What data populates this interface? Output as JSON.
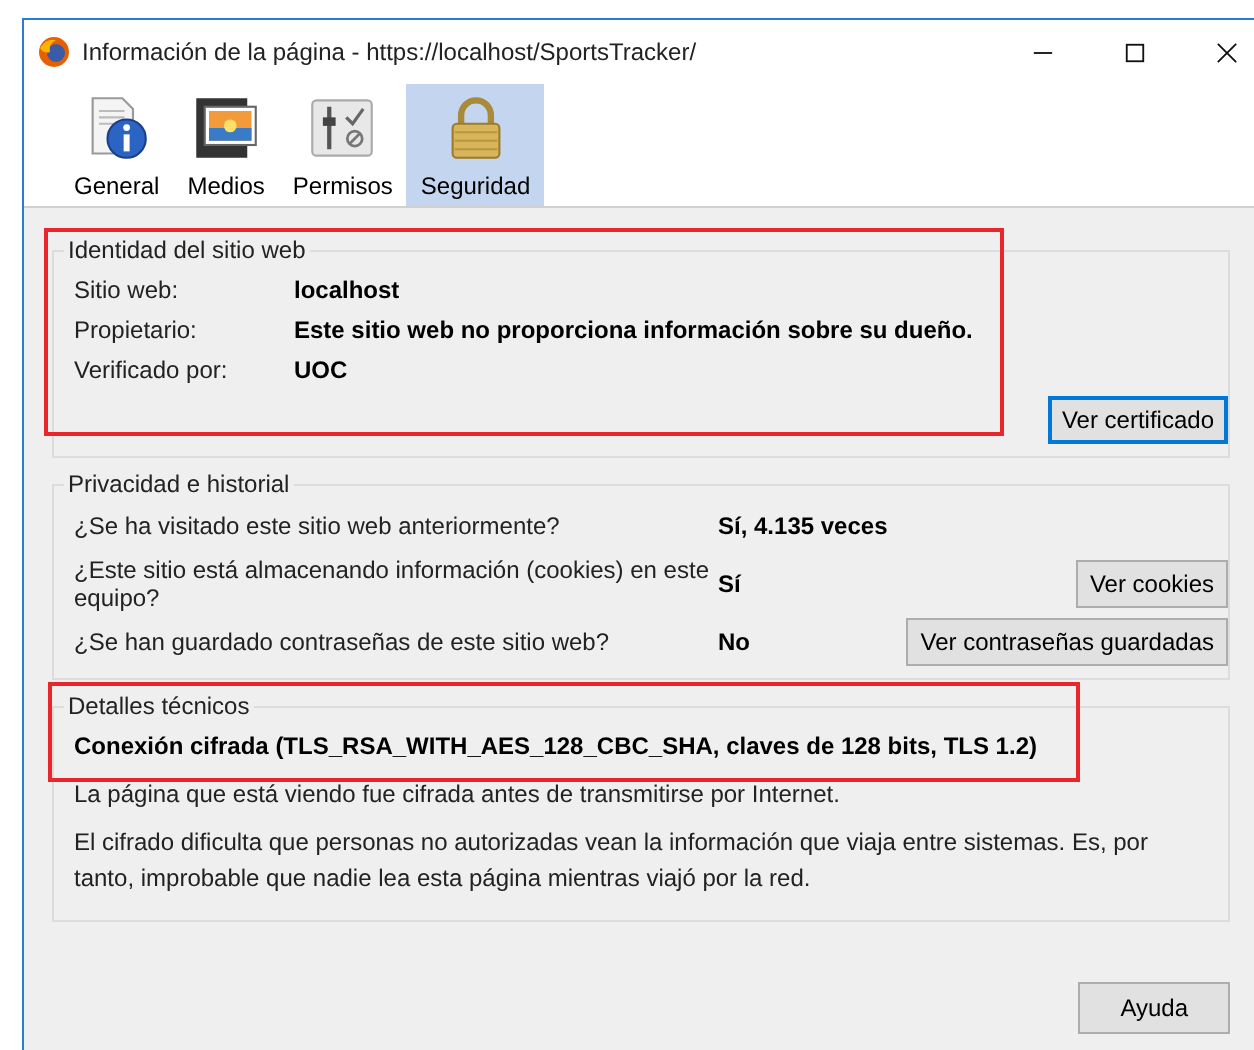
{
  "window": {
    "title": "Información de la página - https://localhost/SportsTracker/"
  },
  "tabs": [
    {
      "label": "General",
      "kind": "general",
      "selected": false
    },
    {
      "label": "Medios",
      "kind": "media",
      "selected": false
    },
    {
      "label": "Permisos",
      "kind": "permissions",
      "selected": false
    },
    {
      "label": "Seguridad",
      "kind": "security",
      "selected": true
    }
  ],
  "identity": {
    "title": "Identidad del sitio web",
    "highlighted": true,
    "rows": [
      {
        "label": "Sitio web:",
        "value": "localhost"
      },
      {
        "label": "Propietario:",
        "value": "Este sitio web no proporciona información sobre su dueño."
      },
      {
        "label": "Verificado por:",
        "value": "UOC"
      }
    ],
    "button": {
      "label": "Ver certificado",
      "focused": true
    }
  },
  "privacy": {
    "title": "Privacidad e historial",
    "rows": [
      {
        "question": "¿Se ha visitado este sitio web anteriormente?",
        "answer": "Sí, 4.135 veces"
      },
      {
        "question": "¿Este sitio está almacenando información (cookies) en este equipo?",
        "answer": "Sí",
        "button": "Ver cookies"
      },
      {
        "question": "¿Se han guardado contraseñas de este sitio web?",
        "answer": "No",
        "button": "Ver contraseñas guardadas"
      }
    ]
  },
  "technical": {
    "title": "Detalles técnicos",
    "highlighted": true,
    "headline": "Conexión cifrada (TLS_RSA_WITH_AES_128_CBC_SHA, claves de 128 bits, TLS 1.2)",
    "paragraphs": [
      "La página que está viendo fue cifrada antes de transmitirse por Internet.",
      "El cifrado dificulta que personas no autorizadas vean la información que viaja entre sistemas. Es, por tanto, improbable que nadie lea esta página mientras viajó por la red."
    ]
  },
  "help_button": "Ayuda"
}
